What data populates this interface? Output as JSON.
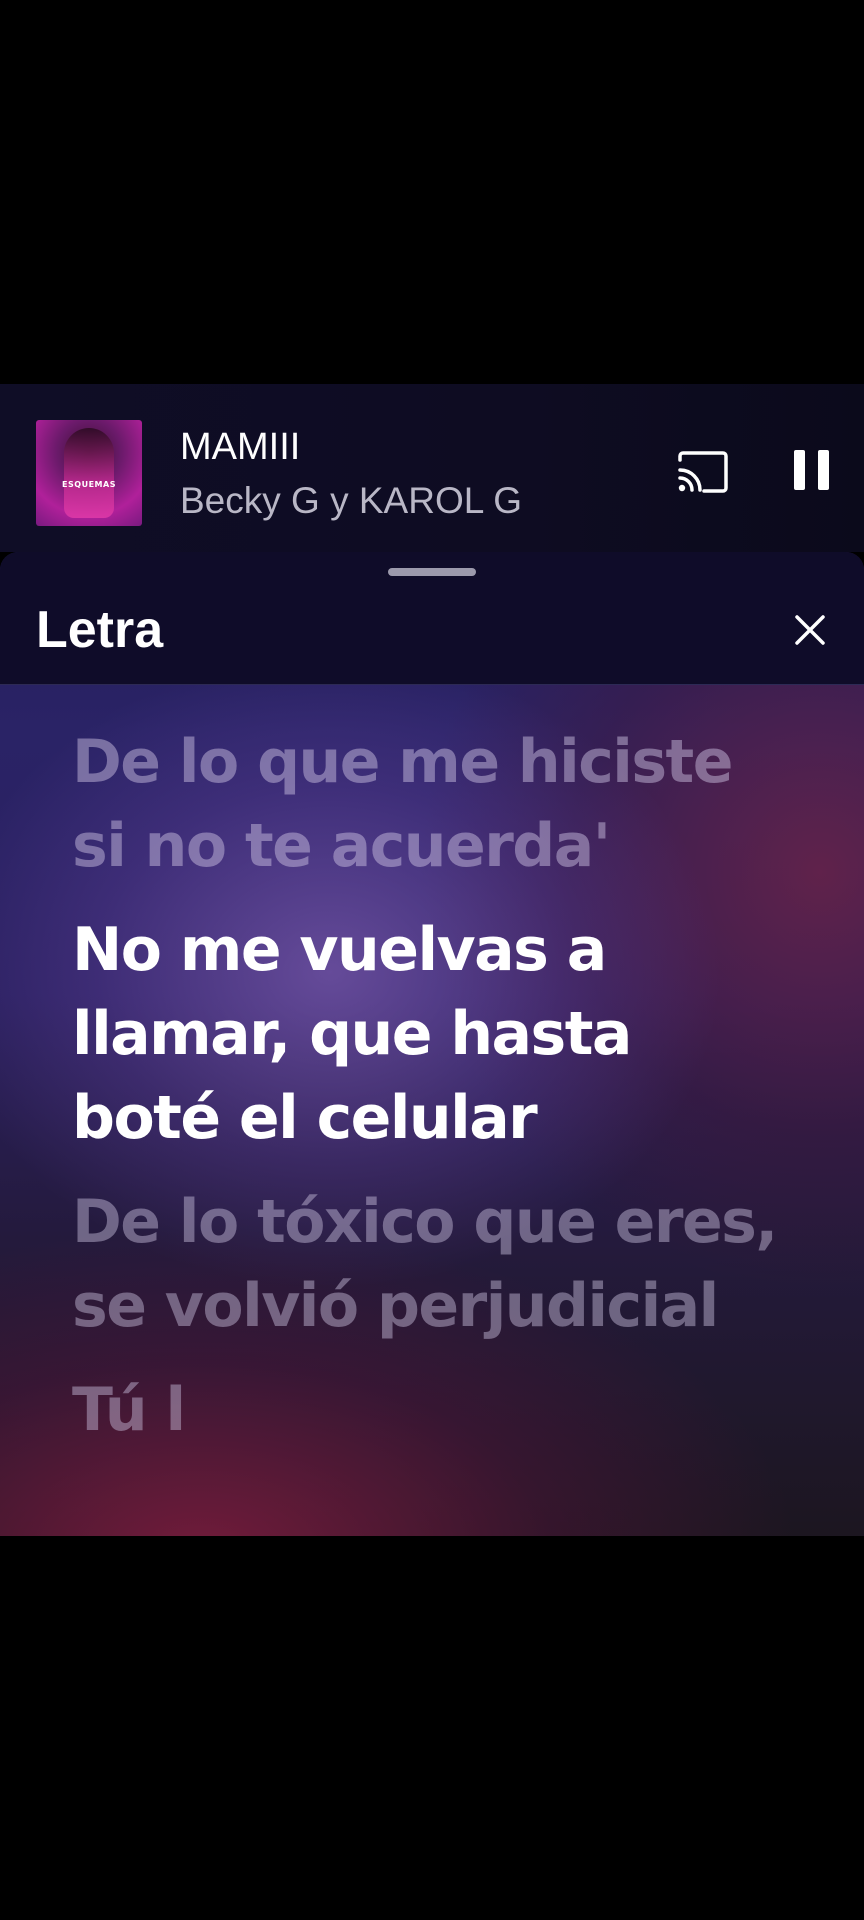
{
  "player": {
    "album_art_label": "ESQUEMAS",
    "track_title": "MAMIII",
    "artist": "Becky G y KAROL G",
    "cast_icon": "cast-icon",
    "pause_icon": "pause-icon"
  },
  "lyrics_sheet": {
    "title": "Letra",
    "close_icon": "close-icon",
    "lines": [
      {
        "text": "De lo que me hiciste si no te acuerda'",
        "state": "past"
      },
      {
        "text": "No me vuelvas a llamar, que hasta boté el celular",
        "state": "current"
      },
      {
        "text": "De lo tóxico que eres, se volvió perjudicial",
        "state": "upcoming"
      },
      {
        "text": "Tú l",
        "state": "upcoming-partial"
      }
    ]
  },
  "colors": {
    "player_bg": "#0f0d26",
    "header_bg": "#0f0c29",
    "active_lyric": "#ffffff",
    "dim_lyric": "#cdc3e1"
  }
}
